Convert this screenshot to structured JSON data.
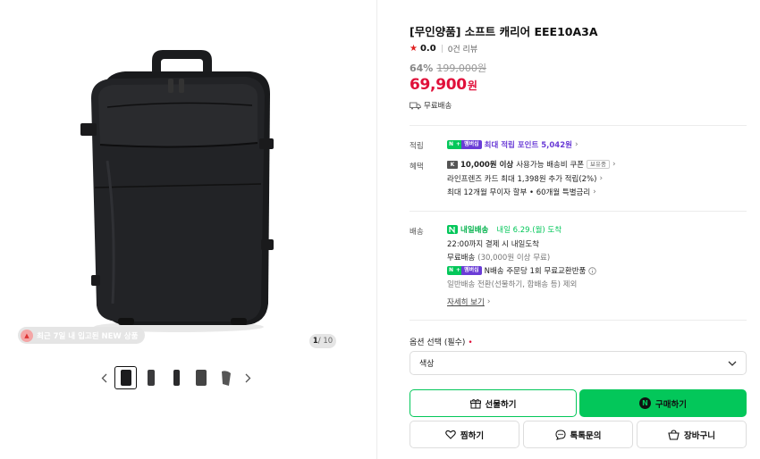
{
  "gallery": {
    "badge_text": "최근 7일 내 입고된 NEW 상품",
    "badge_icon": "flame-icon",
    "counter_current": "1",
    "counter_total": " / 10",
    "thumbnail_count": 5
  },
  "product": {
    "title": "[무인양품] 소프트 캐리어 EEE10A3A",
    "rating": "0.0",
    "review_count": "0건 리뷰",
    "discount_rate": "64%",
    "original_price": "199,000원",
    "price": "69,900",
    "currency": "원",
    "shipping_badge": "무료배송"
  },
  "benefits": {
    "points_label": "적립",
    "points_badge_n": "N",
    "points_badge_plus": "+",
    "points_badge_member": "멤버십",
    "points_text": "최대 적립 포인트 5,042원",
    "perks_label": "혜택",
    "coupon_amount": "10,000원 이상",
    "coupon_text": "사용가능 배송비 쿠폰",
    "coupon_badge": "보유중",
    "card_text": "라인프렌즈 카드 최대 1,398원 추가 적립(2%)",
    "installment_text": "최대 12개월 무이자 할부 • 60개월 특별금리"
  },
  "delivery": {
    "label": "배송",
    "fast_label": "내일배송",
    "arrival": "내일 6.29.(월) 도착",
    "cutoff": "22:00까지 결제 시 내일도착",
    "free_shipping": "무료배송",
    "free_condition": "(30,000원 이상 무료)",
    "exchange_text": "N배송 주문당 1회 무료교환반품",
    "exception_text": "일반배송 전환(선물하기, 합배송 등) 제외",
    "details_link": "자세히 보기"
  },
  "options": {
    "label": "옵션 선택 (필수)",
    "required_mark": "•",
    "color_placeholder": "색상"
  },
  "actions": {
    "gift": "선물하기",
    "buy": "구매하기",
    "wishlist": "찜하기",
    "talk": "톡톡문의",
    "cart": "장바구니"
  },
  "colors": {
    "accent_green": "#03c75a",
    "price_red": "#e0103a",
    "membership_purple": "#6a3cd6"
  }
}
